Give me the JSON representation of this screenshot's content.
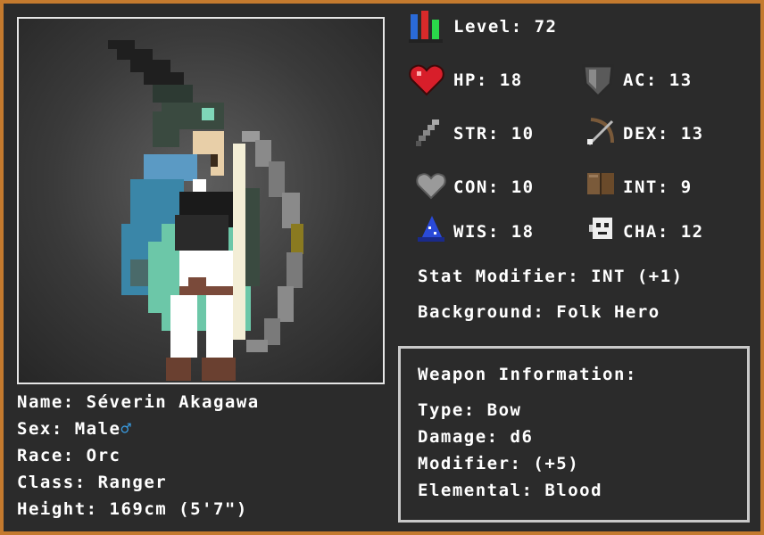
{
  "stats": {
    "level": "Level: 72",
    "hp": "HP: 18",
    "ac": "AC: 13",
    "str": "STR: 10",
    "dex": "DEX: 13",
    "con": "CON: 10",
    "int": "INT: 9",
    "wis": "WIS: 18",
    "cha": "CHA: 12",
    "stat_modifier": "Stat Modifier: INT (+1)",
    "background": "Background: Folk Hero"
  },
  "character": {
    "name": "Name: Séverin Akagawa",
    "sex": "Sex: Male",
    "sex_symbol": "♂",
    "race": "Race: Orc",
    "class": "Class: Ranger",
    "height": "Height: 169cm (5'7\")"
  },
  "weapon": {
    "header": "Weapon Information:",
    "type": "Type: Bow",
    "damage": "Damage: d6",
    "modifier": "Modifier: (+5)",
    "elemental": "Elemental: Blood"
  },
  "colors": {
    "frame": "#c47a2e",
    "background": "#2b2b2b",
    "text": "#ffffff",
    "male_symbol": "#3aa0e8"
  },
  "icons": [
    "level-bars-icon",
    "heart-icon",
    "shield-icon",
    "sword-icon",
    "bow-arrow-icon",
    "grey-heart-icon",
    "book-icon",
    "wizard-hat-icon",
    "mask-icon"
  ]
}
